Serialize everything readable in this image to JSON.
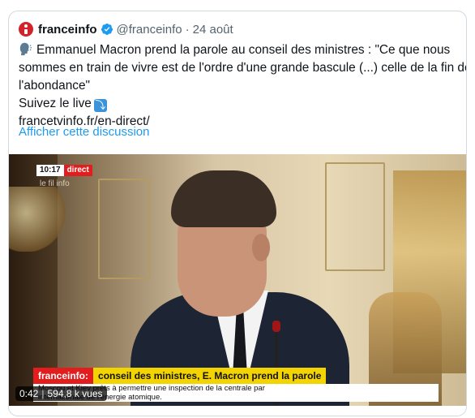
{
  "tweet": {
    "author_name": "franceinfo",
    "handle": "@franceinfo",
    "separator": "·",
    "date": "24 août",
    "text_lines": [
      "Emmanuel Macron prend la parole au conseil des ministres : \"Ce que nous",
      "sommes en train de vivre est de l'ordre d'une grande bascule (...) celle de la fin de",
      "l'abondance\""
    ],
    "follow_text": "Suivez le live",
    "link_text": "francetvinfo.fr/en-direct/",
    "show_thread": "Afficher cette discussion"
  },
  "video": {
    "time": "10:17",
    "live_badge": "direct",
    "channel_watermark": "le fil info",
    "lower_third_brand": "franceinfo:",
    "lower_third_title": "conseil des ministres, E. Macron prend la parole",
    "ticker_lines": [
      "Moscou et Kiev prêts à permettre une inspection de la centrale par",
      "internationale de l'énergie atomique."
    ],
    "duration": "0:42",
    "views": "594,8 k vues"
  },
  "icons": {
    "logo": "franceinfo-logo-icon",
    "verified": "verified-badge-icon",
    "speaking": "speaking-head-icon",
    "arrow": "arrow-curve-down-icon"
  },
  "colors": {
    "link_blue": "#1d9bf0",
    "secondary_text": "#536471",
    "live_red": "#e21d1d",
    "lower_third_yellow": "#f4d400"
  }
}
